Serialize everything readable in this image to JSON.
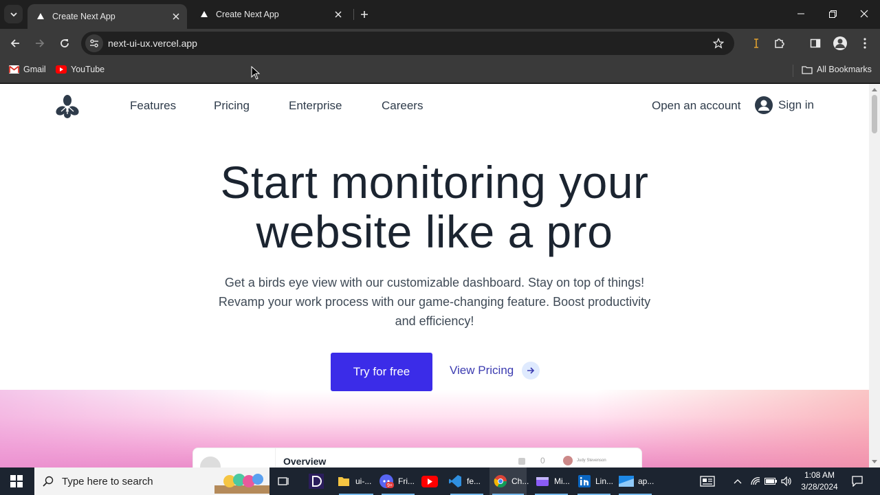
{
  "browser": {
    "tabs": [
      {
        "title": "Create Next App",
        "active": true
      },
      {
        "title": "Create Next App",
        "active": false
      }
    ],
    "url": "next-ui-ux.vercel.app",
    "bookmarks": [
      "Gmail",
      "YouTube"
    ],
    "all_bookmarks": "All Bookmarks"
  },
  "site": {
    "nav": [
      "Features",
      "Pricing",
      "Enterprise",
      "Careers"
    ],
    "open_account": "Open an account",
    "sign_in": "Sign in",
    "hero_line1": "Start monitoring your",
    "hero_line2": "website like a pro",
    "subtitle_line1": "Get a birds eye view with our customizable dashboard. Stay on top of things!",
    "subtitle_line2": "Revamp your work process with our game-changing feature. Boost productivity",
    "subtitle_line3": "and efficiency!",
    "cta_primary": "Try for free",
    "cta_secondary": "View Pricing",
    "dashboard_title": "Overview",
    "dashboard_user": "Judy Stevenson",
    "dashboard_count": "0"
  },
  "taskbar": {
    "search_placeholder": "Type here to search",
    "apps": [
      {
        "name": "file-explorer",
        "label": "ui-..."
      },
      {
        "name": "discord",
        "label": "Fri..."
      },
      {
        "name": "youtube",
        "label": ""
      },
      {
        "name": "vscode",
        "label": "fe..."
      },
      {
        "name": "chrome",
        "label": "Ch..."
      },
      {
        "name": "video",
        "label": "Mi..."
      },
      {
        "name": "linkedin",
        "label": "Lin..."
      },
      {
        "name": "app",
        "label": "ap..."
      }
    ],
    "discord_badge": "9+",
    "time": "1:08 AM",
    "date": "3/28/2024"
  },
  "colors": {
    "accent": "#3b2ce8",
    "link": "#3b3bb0",
    "heading": "#1b2430"
  }
}
